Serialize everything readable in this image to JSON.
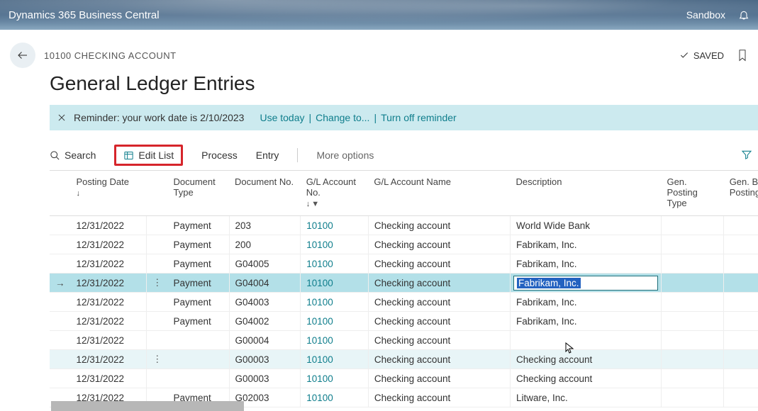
{
  "app": {
    "title": "Dynamics 365 Business Central",
    "env_tag": "Sandbox"
  },
  "header": {
    "breadcrumb": "10100 CHECKING ACCOUNT",
    "page_title": "General Ledger Entries",
    "saved_label": "SAVED"
  },
  "notification": {
    "text": "Reminder: your work date is 2/10/2023",
    "links": {
      "use_today": "Use today",
      "change_to": "Change to...",
      "turn_off": "Turn off reminder"
    }
  },
  "actions": {
    "search": "Search",
    "edit_list": "Edit List",
    "process": "Process",
    "entry": "Entry",
    "more": "More options"
  },
  "columns": {
    "posting_date": "Posting Date",
    "doc_type": "Document Type",
    "doc_no": "Document No.",
    "gl_acct_no": "G/L Account No.",
    "gl_acct_name": "G/L Account Name",
    "description": "Description",
    "gen_posting_type": "Gen. Posting Type",
    "gen_bus_posting": "Gen. Bu Posting"
  },
  "rows": [
    {
      "posting_date": "12/31/2022",
      "doc_type": "Payment",
      "doc_no": "203",
      "gl_no": "10100",
      "gl_name": "Checking account",
      "desc": "World Wide Bank"
    },
    {
      "posting_date": "12/31/2022",
      "doc_type": "Payment",
      "doc_no": "200",
      "gl_no": "10100",
      "gl_name": "Checking account",
      "desc": "Fabrikam, Inc."
    },
    {
      "posting_date": "12/31/2022",
      "doc_type": "Payment",
      "doc_no": "G04005",
      "gl_no": "10100",
      "gl_name": "Checking account",
      "desc": "Fabrikam, Inc."
    },
    {
      "posting_date": "12/31/2022",
      "doc_type": "Payment",
      "doc_no": "G04004",
      "gl_no": "10100",
      "gl_name": "Checking account",
      "desc": "Fabrikam, Inc."
    },
    {
      "posting_date": "12/31/2022",
      "doc_type": "Payment",
      "doc_no": "G04003",
      "gl_no": "10100",
      "gl_name": "Checking account",
      "desc": "Fabrikam, Inc."
    },
    {
      "posting_date": "12/31/2022",
      "doc_type": "Payment",
      "doc_no": "G04002",
      "gl_no": "10100",
      "gl_name": "Checking account",
      "desc": "Fabrikam, Inc."
    },
    {
      "posting_date": "12/31/2022",
      "doc_type": "",
      "doc_no": "G00004",
      "gl_no": "10100",
      "gl_name": "Checking account",
      "desc": ""
    },
    {
      "posting_date": "12/31/2022",
      "doc_type": "",
      "doc_no": "G00003",
      "gl_no": "10100",
      "gl_name": "Checking account",
      "desc": "Checking account"
    },
    {
      "posting_date": "12/31/2022",
      "doc_type": "",
      "doc_no": "G00003",
      "gl_no": "10100",
      "gl_name": "Checking account",
      "desc": "Checking account"
    },
    {
      "posting_date": "12/31/2022",
      "doc_type": "Payment",
      "doc_no": "G02003",
      "gl_no": "10100",
      "gl_name": "Checking account",
      "desc": "Litware, Inc."
    }
  ],
  "selected_row_index": 3,
  "hover_row_index": 7
}
